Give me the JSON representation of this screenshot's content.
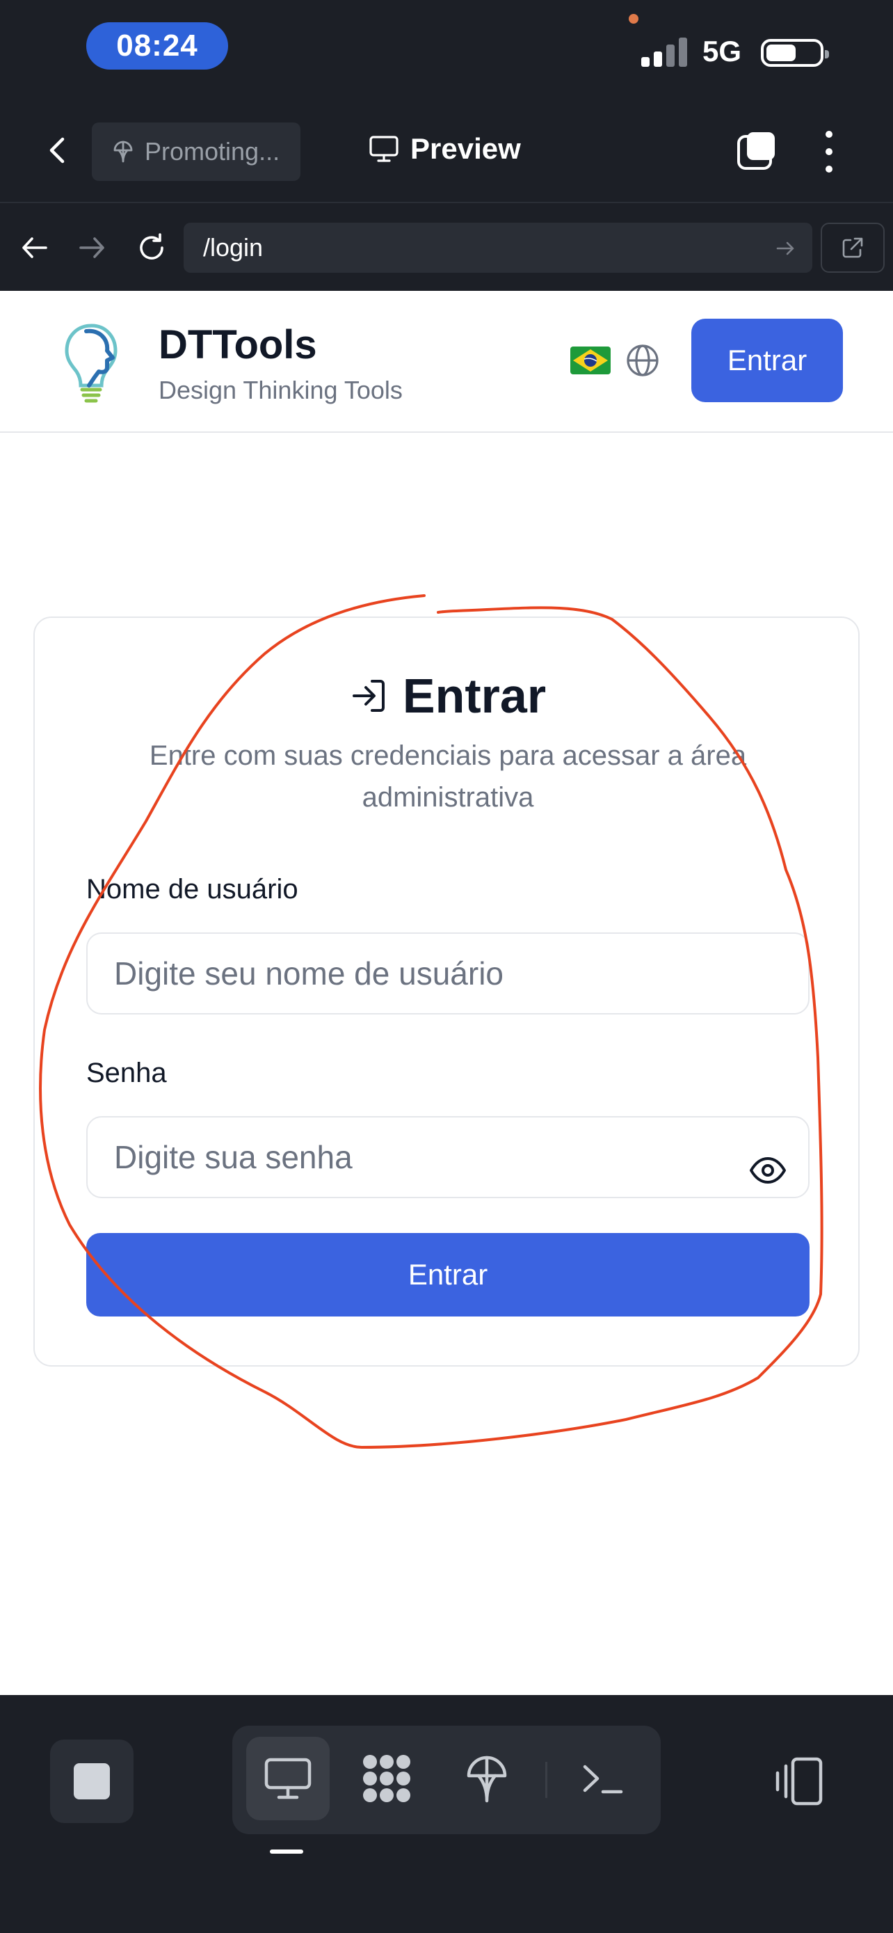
{
  "status_bar": {
    "time": "08:24",
    "network": "5G"
  },
  "toolbar": {
    "project_label": "Promoting...",
    "preview_label": "Preview"
  },
  "url_bar": {
    "url": "/login"
  },
  "site": {
    "brand_title": "DTTools",
    "brand_subtitle": "Design Thinking Tools",
    "header_button": "Entrar"
  },
  "login": {
    "title": "Entrar",
    "description": "Entre com suas credenciais para acessar a área administrativa",
    "username_label": "Nome de usuário",
    "username_placeholder": "Digite seu nome de usuário",
    "password_label": "Senha",
    "password_placeholder": "Digite sua senha",
    "submit_label": "Entrar"
  },
  "colors": {
    "accent": "#3b63e0",
    "annotation": "#e8431f",
    "chrome_bg": "#1c1f26"
  },
  "icons": [
    "back-chevron-icon",
    "promo-icon",
    "monitor-icon",
    "tabs-icon",
    "more-icon",
    "arrow-left-icon",
    "arrow-right-icon",
    "reload-icon",
    "url-go-icon",
    "external-link-icon",
    "logo-icon",
    "brazil-flag-icon",
    "globe-icon",
    "login-icon",
    "eye-icon",
    "stop-icon",
    "grid-icon",
    "terminal-icon",
    "layout-icon"
  ]
}
